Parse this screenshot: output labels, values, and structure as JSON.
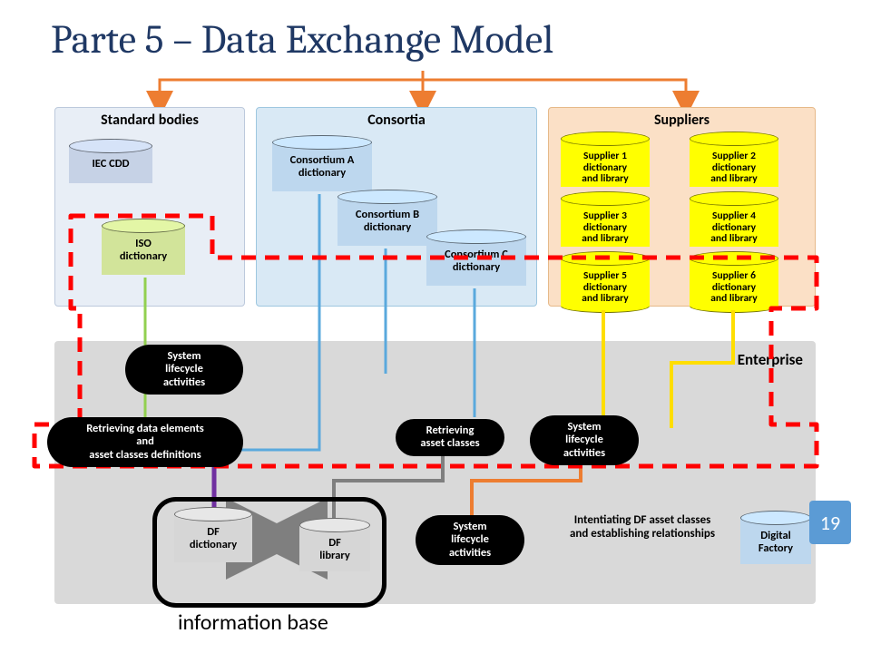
{
  "title": "Parte 5 – Data Exchange Model",
  "page_number": "19",
  "columns": {
    "standard": {
      "header": "Standard bodies",
      "items": [
        {
          "id": "iec",
          "label": "IEC CDD"
        },
        {
          "id": "iso",
          "label": "ISO\ndictionary"
        }
      ]
    },
    "consortia": {
      "header": "Consortia",
      "items": [
        {
          "id": "ca",
          "label": "Consortium A\ndictionary"
        },
        {
          "id": "cb",
          "label": "Consortium B\ndictionary"
        },
        {
          "id": "cc",
          "label": "Consortium C\ndictionary"
        }
      ]
    },
    "suppliers": {
      "header": "Suppliers",
      "items": [
        {
          "id": "s1",
          "label": "Supplier 1\ndictionary\nand library"
        },
        {
          "id": "s2",
          "label": "Supplier 2\ndictionary\nand library"
        },
        {
          "id": "s3",
          "label": "Supplier 3\ndictionary\nand library"
        },
        {
          "id": "s4",
          "label": "Supplier 4\ndictionary\nand library"
        },
        {
          "id": "s5",
          "label": "Supplier 5\ndictionary\nand library"
        },
        {
          "id": "s6",
          "label": "Supplier 6\ndictionary\nand library"
        }
      ]
    }
  },
  "enterprise_label": "Enterprise",
  "pills": {
    "sla1": "System\nlifecycle\nactivities",
    "retrieve_defs": "Retrieving data elements\nand\nasset classes definitions",
    "retrieve_assets": "Retrieving\nasset classes",
    "sla2": "System\nlifecycle\nactivities",
    "sla3": "System\nlifecycle\nactivities",
    "intentiating": "Intentiating DF asset classes\nand establishing relationships"
  },
  "info_base": {
    "df_dict": "DF\ndictionary",
    "df_lib": "DF\nlibrary",
    "digital_factory": "Digital\nFactory",
    "caption": "information base"
  },
  "colors": {
    "title": "#1f3864",
    "standard_bg": "#e8eef6",
    "standard_border": "#bcc9dc",
    "consortia_bg": "#d9e9f5",
    "consortia_border": "#9ec7e0",
    "suppliers_bg": "#fbe0c6",
    "suppliers_border": "#e6b989",
    "enterprise_bg": "#d9d9d9",
    "iec_cyl": "#c6d2e6",
    "iso_cyl": "#d2e49a",
    "consortia_cyl": "#bdd7ee",
    "supplier_cyl": "#ffff00",
    "df_cyl": "#d6d6d6",
    "digital_cyl": "#bdd7ee",
    "red": "#ff0000",
    "page_badge": "#5b9bd5"
  }
}
